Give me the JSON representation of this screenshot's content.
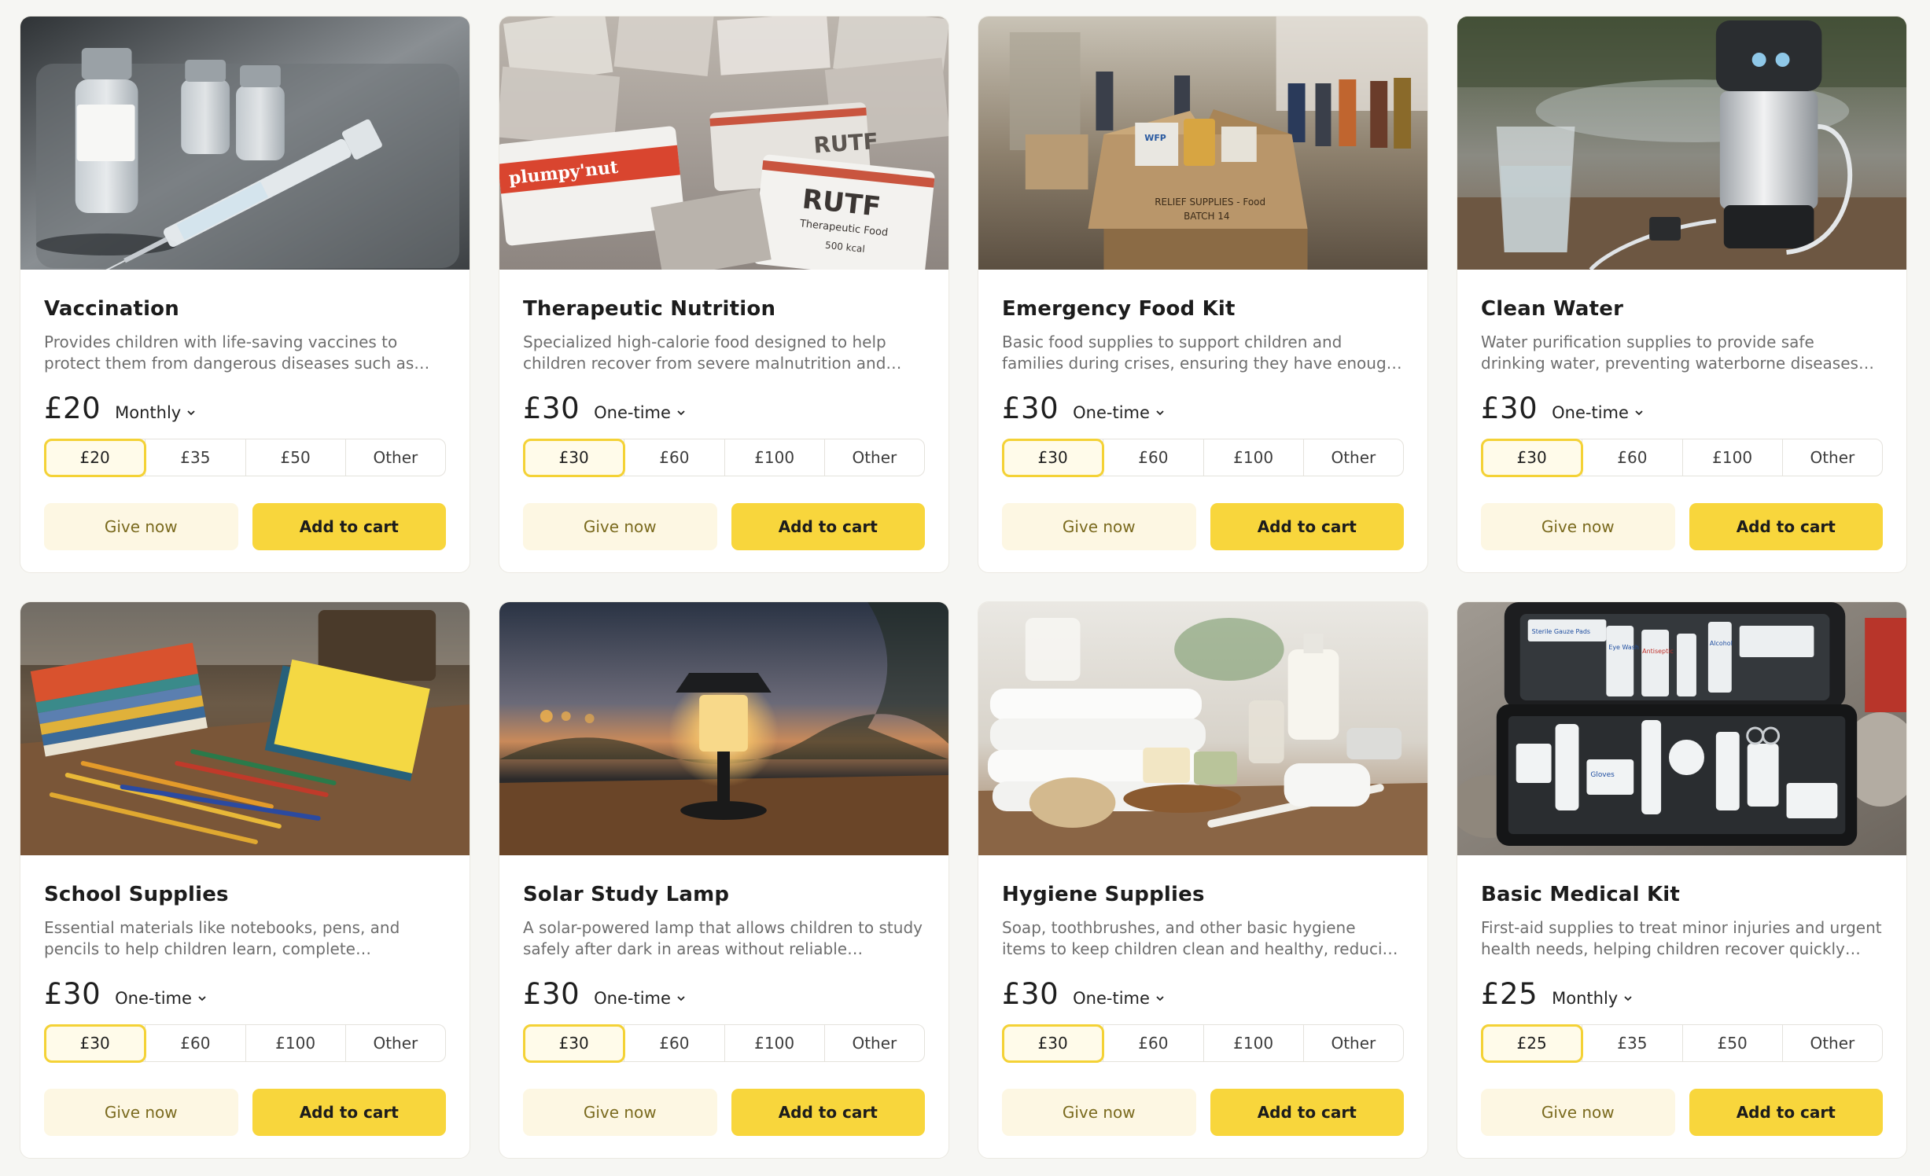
{
  "colors": {
    "accent": "#f8d63c",
    "accent_light": "#fdf7e3",
    "selected_border": "#f4d236",
    "background": "#f6f6f3"
  },
  "cards": [
    {
      "title": "Vaccination",
      "description": "Provides children with life-saving vaccines to protect them from dangerous diseases such as measles, polio and other preventable illnesses.",
      "price": "£20",
      "frequency": "Monthly",
      "amounts": [
        "£20",
        "£35",
        "£50",
        "Other"
      ],
      "selected_amount": "£20",
      "give_label": "Give now",
      "cart_label": "Add to cart",
      "image": "vaccine-vials-syringe-image"
    },
    {
      "title": "Therapeutic Nutrition",
      "description": "Specialized high-calorie food designed to help children recover from severe malnutrition and regain their strength.",
      "price": "£30",
      "frequency": "One-time",
      "amounts": [
        "£30",
        "£60",
        "£100",
        "Other"
      ],
      "selected_amount": "£30",
      "give_label": "Give now",
      "cart_label": "Add to cart",
      "image": "rutf-sachets-image",
      "image_text": [
        "plumpy'nut",
        "RUTF",
        "RUTF",
        "Therapeutic Food",
        "500 kcal"
      ]
    },
    {
      "title": "Emergency Food Kit",
      "description": "Basic food supplies to support children and families during crises, ensuring they have enough to eat when it matters most.",
      "price": "£30",
      "frequency": "One-time",
      "amounts": [
        "£30",
        "£60",
        "£100",
        "Other"
      ],
      "selected_amount": "£30",
      "give_label": "Give now",
      "cart_label": "Add to cart",
      "image": "relief-food-box-warehouse-image",
      "image_text": [
        "WFP",
        "RELIEF SUPPLIES - Food",
        "BATCH 14"
      ]
    },
    {
      "title": "Clean Water",
      "description": "Water purification supplies to provide safe drinking water, preventing waterborne diseases and protecting children's health.",
      "price": "£30",
      "frequency": "One-time",
      "amounts": [
        "£30",
        "£60",
        "£100",
        "Other"
      ],
      "selected_amount": "£30",
      "give_label": "Give now",
      "cart_label": "Add to cart",
      "image": "water-filter-glass-image"
    },
    {
      "title": "School Supplies",
      "description": "Essential materials like notebooks, pens, and pencils to help children learn, complete schoolwork, and stay engaged in education.",
      "price": "£30",
      "frequency": "One-time",
      "amounts": [
        "£30",
        "£60",
        "£100",
        "Other"
      ],
      "selected_amount": "£30",
      "give_label": "Give now",
      "cart_label": "Add to cart",
      "image": "notebooks-pencils-desk-image"
    },
    {
      "title": "Solar Study Lamp",
      "description": "A solar-powered lamp that allows children to study safely after dark in areas without reliable electricity.",
      "price": "£30",
      "frequency": "One-time",
      "amounts": [
        "£30",
        "£60",
        "£100",
        "Other"
      ],
      "selected_amount": "£30",
      "give_label": "Give now",
      "cart_label": "Add to cart",
      "image": "solar-lamp-dusk-image"
    },
    {
      "title": "Hygiene Supplies",
      "description": "Soap, toothbrushes, and other basic hygiene items to keep children clean and healthy, reducing the spread of illness.",
      "price": "£30",
      "frequency": "One-time",
      "amounts": [
        "£30",
        "£60",
        "£100",
        "Other"
      ],
      "selected_amount": "£30",
      "give_label": "Give now",
      "cart_label": "Add to cart",
      "image": "towels-soap-toothbrush-image"
    },
    {
      "title": "Basic Medical Kit",
      "description": "First-aid supplies to treat minor injuries and urgent health needs, helping children recover quickly from everyday harm.",
      "price": "£25",
      "frequency": "Monthly",
      "amounts": [
        "£25",
        "£35",
        "£50",
        "Other"
      ],
      "selected_amount": "£25",
      "give_label": "Give now",
      "cart_label": "Add to cart",
      "image": "first-aid-kit-open-image",
      "image_text": [
        "Sterile Gauze Pads",
        "Eye Wash",
        "Antiseptic",
        "Alcohol",
        "Gloves"
      ]
    }
  ]
}
